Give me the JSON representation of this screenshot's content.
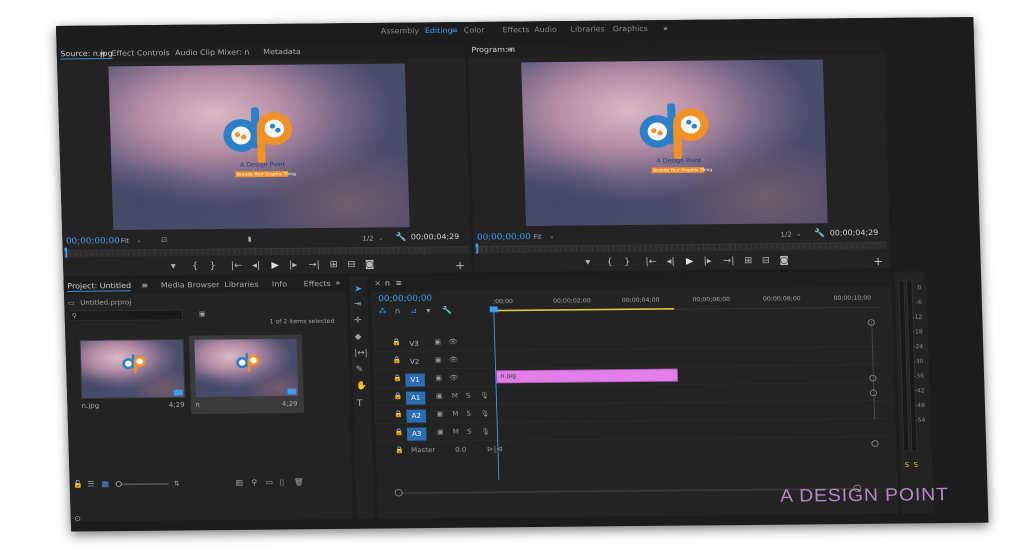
{
  "workspaces": {
    "tabs": [
      "Assembly",
      "Editing",
      "Color",
      "Effects",
      "Audio",
      "Libraries",
      "Graphics"
    ],
    "active": "Editing",
    "more": "»",
    "menu_glyph": "≡"
  },
  "source_panel": {
    "tabs": [
      "Source: n.jpg",
      "Effect Controls",
      "Audio Clip Mixer: n",
      "Metadata"
    ],
    "timecode": "00;00;00;00",
    "fit": "Fit",
    "resolution": "1/2",
    "duration": "00;00;04;29"
  },
  "program_panel": {
    "tab": "Program: n",
    "timecode": "00;00;00;00",
    "fit": "Fit",
    "resolution": "1/2",
    "duration": "00;00;04;29"
  },
  "logo": {
    "tagline": "A Design Point",
    "subtitle": "Brande Your Graphic Thing"
  },
  "project_panel": {
    "tabs": [
      "Project: Untitled",
      "Media Browser",
      "Libraries",
      "Info",
      "Effects"
    ],
    "more": "»",
    "file": "Untitled.prproj",
    "selection": "1 of 2 items selected",
    "items": [
      {
        "name": "n.jpg",
        "duration": "4;29"
      },
      {
        "name": "n",
        "duration": "4;29"
      }
    ]
  },
  "timeline_panel": {
    "tab": "n",
    "timecode": "00;00;00;00",
    "ruler": [
      ";00;00",
      "00;00;02;00",
      "00;00;04;00",
      "00;00;06;00",
      "00;00;08;00",
      "00;00;10;00"
    ],
    "video_tracks": [
      "V3",
      "V2",
      "V1"
    ],
    "audio_tracks": [
      "A1",
      "A2",
      "A3"
    ],
    "master_label": "Master",
    "master_value": "0.0",
    "clip_label": "n.jpg",
    "clip_color": "#e37ee8"
  },
  "meters": {
    "db_ticks": [
      "0",
      "-6",
      "-12",
      "-18",
      "-24",
      "-30",
      "-36",
      "-42",
      "-48",
      "-54"
    ],
    "solo": [
      "S",
      "S"
    ]
  },
  "watermark_text": "A DESIGN POINT",
  "colors": {
    "accent": "#3d9df3",
    "app_bg": "#1c1c1c",
    "panel_bg": "#232323",
    "clip": "#e37ee8"
  }
}
